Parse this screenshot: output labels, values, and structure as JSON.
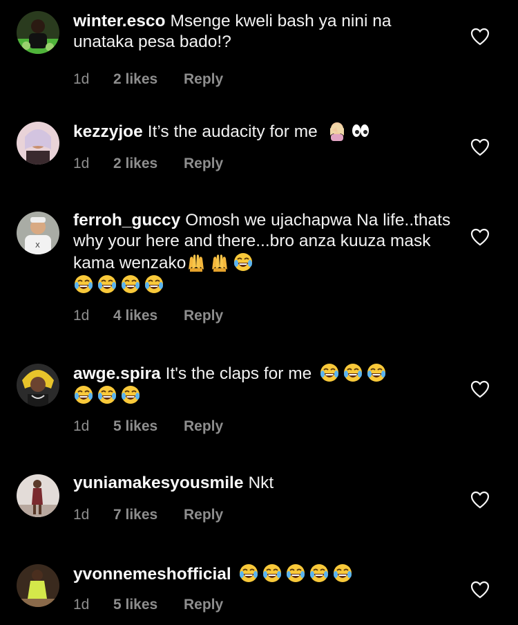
{
  "comments": [
    {
      "username": "winter.esco",
      "text": "Msenge kweli bash ya nini na unataka pesa bado!?",
      "emojis": [],
      "time": "1d",
      "likes": "2 likes",
      "reply": "Reply",
      "avatar_color": "#3a7d2c"
    },
    {
      "username": "kezzyjoe",
      "text": "It’s the audacity for me",
      "emojis": [
        "facepalm-emoji",
        "eyes-emoji"
      ],
      "time": "1d",
      "likes": "2 likes",
      "reply": "Reply",
      "avatar_color": "#b06a8a"
    },
    {
      "username": "ferroh_guccy",
      "text": "Omosh we ujachapwa Na life..thats why your here and there...bro anza kuuza mask kama wenzako",
      "emojis": [
        "raised-hands-emoji",
        "raised-hands-emoji",
        "joy-emoji",
        "joy-emoji",
        "joy-emoji",
        "joy-emoji",
        "joy-emoji"
      ],
      "time": "1d",
      "likes": "4 likes",
      "reply": "Reply",
      "avatar_color": "#8a8f86"
    },
    {
      "username": "awge.spira",
      "text": "It's the claps for me",
      "emojis": [
        "joy-emoji",
        "joy-emoji",
        "joy-emoji",
        "joy-emoji",
        "joy-emoji",
        "joy-emoji"
      ],
      "time": "1d",
      "likes": "5 likes",
      "reply": "Reply",
      "avatar_color": "#d9b928"
    },
    {
      "username": "yuniamakesyousmile",
      "text": "Nkt",
      "emojis": [],
      "time": "1d",
      "likes": "7 likes",
      "reply": "Reply",
      "avatar_color": "#c7a7a0"
    },
    {
      "username": "yvonnemeshofficial",
      "text": "",
      "emojis": [
        "joy-emoji",
        "joy-emoji",
        "joy-emoji",
        "joy-emoji",
        "joy-emoji"
      ],
      "time": "1d",
      "likes": "5 likes",
      "reply": "Reply",
      "avatar_color": "#6b4a2e"
    }
  ]
}
